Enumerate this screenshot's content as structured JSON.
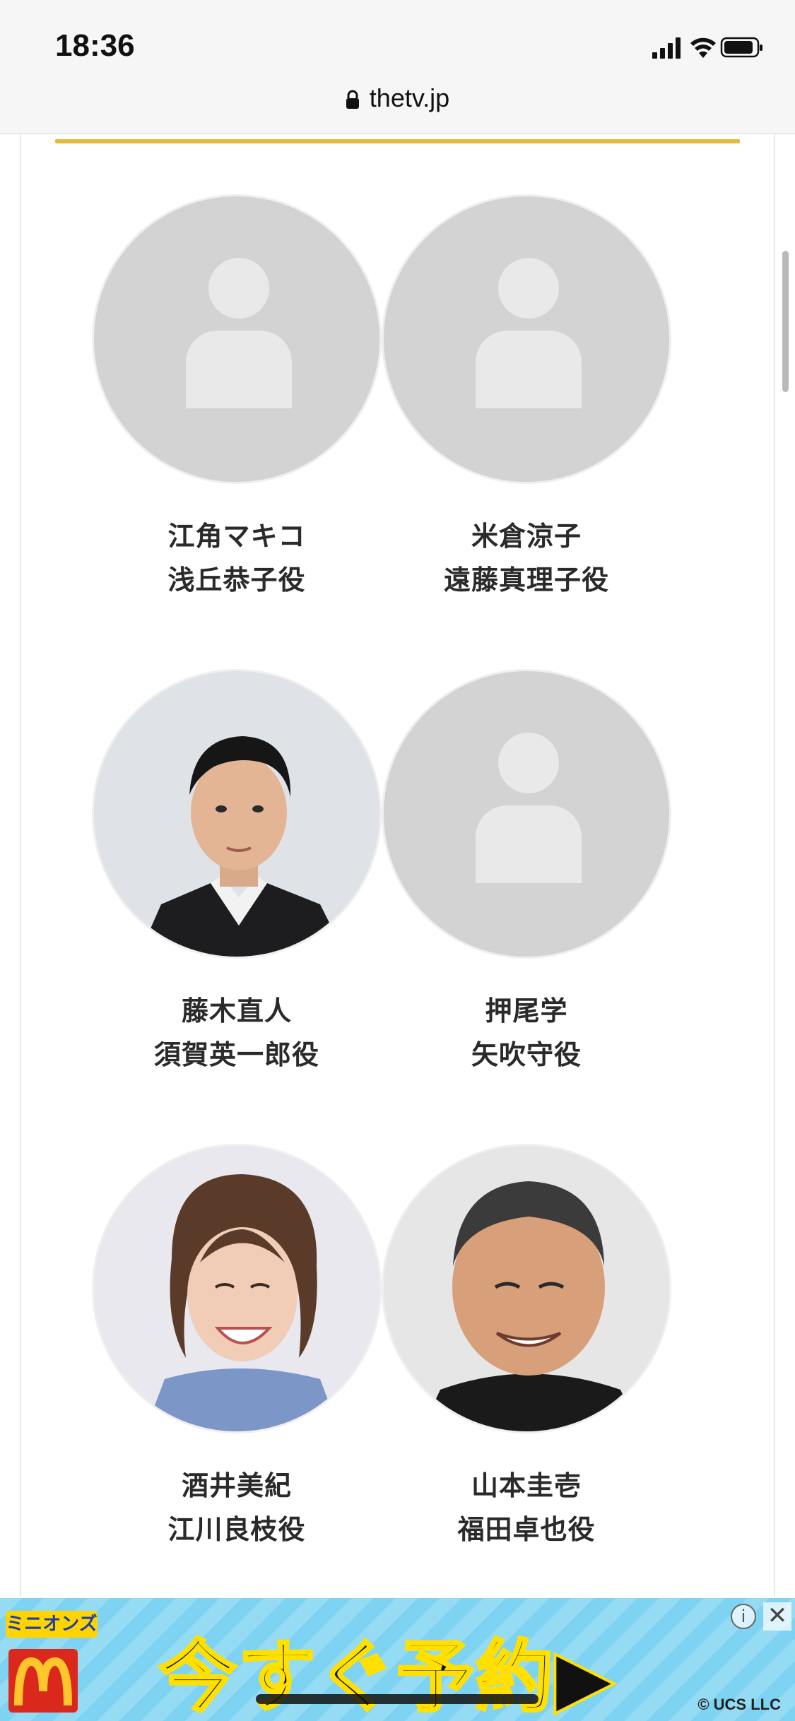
{
  "status_bar": {
    "time": "18:36"
  },
  "browser": {
    "url": "thetv.jp"
  },
  "theme": {
    "accent_color": "#e6b93a",
    "placeholder_bg": "#d3d3d3",
    "placeholder_fg": "#e9e9e9"
  },
  "cast": [
    {
      "name": "江角マキコ",
      "role": "浅丘恭子役",
      "photo": "placeholder"
    },
    {
      "name": "米倉涼子",
      "role": "遠藤真理子役",
      "photo": "placeholder"
    },
    {
      "name": "藤木直人",
      "role": "須賀英一郎役",
      "photo": "man-in-suit"
    },
    {
      "name": "押尾学",
      "role": "矢吹守役",
      "photo": "placeholder"
    },
    {
      "name": "酒井美紀",
      "role": "江川良枝役",
      "photo": "smiling-woman"
    },
    {
      "name": "山本圭壱",
      "role": "福田卓也役",
      "photo": "smiling-man"
    }
  ],
  "ad": {
    "brand_text": "ミニオンズ",
    "cta": "今すぐ予約▶",
    "copyright": "© UCS LLC",
    "info_icon": "i",
    "close_icon": "✕"
  }
}
